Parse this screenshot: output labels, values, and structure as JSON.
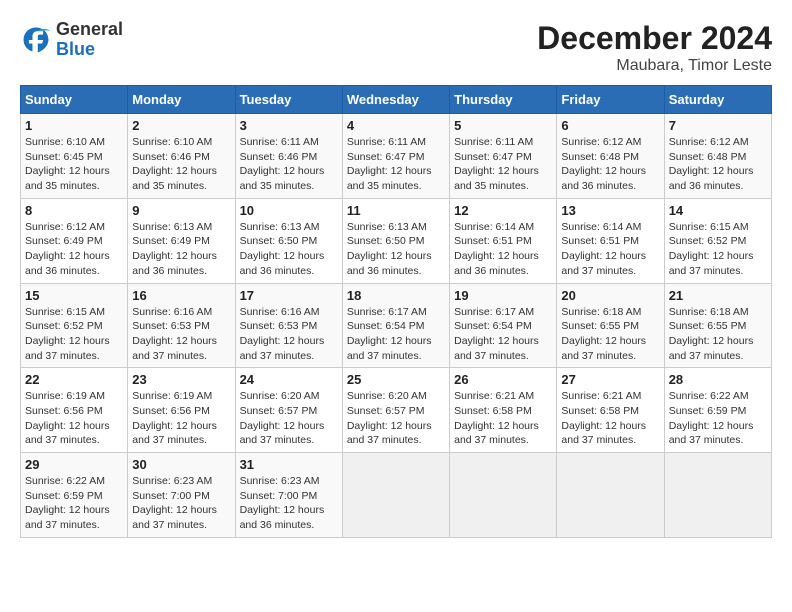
{
  "logo": {
    "general": "General",
    "blue": "Blue"
  },
  "header": {
    "month": "December 2024",
    "location": "Maubara, Timor Leste"
  },
  "weekdays": [
    "Sunday",
    "Monday",
    "Tuesday",
    "Wednesday",
    "Thursday",
    "Friday",
    "Saturday"
  ],
  "weeks": [
    [
      {
        "day": "1",
        "sunrise": "6:10 AM",
        "sunset": "6:45 PM",
        "daylight": "12 hours and 35 minutes."
      },
      {
        "day": "2",
        "sunrise": "6:10 AM",
        "sunset": "6:46 PM",
        "daylight": "12 hours and 35 minutes."
      },
      {
        "day": "3",
        "sunrise": "6:11 AM",
        "sunset": "6:46 PM",
        "daylight": "12 hours and 35 minutes."
      },
      {
        "day": "4",
        "sunrise": "6:11 AM",
        "sunset": "6:47 PM",
        "daylight": "12 hours and 35 minutes."
      },
      {
        "day": "5",
        "sunrise": "6:11 AM",
        "sunset": "6:47 PM",
        "daylight": "12 hours and 35 minutes."
      },
      {
        "day": "6",
        "sunrise": "6:12 AM",
        "sunset": "6:48 PM",
        "daylight": "12 hours and 36 minutes."
      },
      {
        "day": "7",
        "sunrise": "6:12 AM",
        "sunset": "6:48 PM",
        "daylight": "12 hours and 36 minutes."
      }
    ],
    [
      {
        "day": "8",
        "sunrise": "6:12 AM",
        "sunset": "6:49 PM",
        "daylight": "12 hours and 36 minutes."
      },
      {
        "day": "9",
        "sunrise": "6:13 AM",
        "sunset": "6:49 PM",
        "daylight": "12 hours and 36 minutes."
      },
      {
        "day": "10",
        "sunrise": "6:13 AM",
        "sunset": "6:50 PM",
        "daylight": "12 hours and 36 minutes."
      },
      {
        "day": "11",
        "sunrise": "6:13 AM",
        "sunset": "6:50 PM",
        "daylight": "12 hours and 36 minutes."
      },
      {
        "day": "12",
        "sunrise": "6:14 AM",
        "sunset": "6:51 PM",
        "daylight": "12 hours and 36 minutes."
      },
      {
        "day": "13",
        "sunrise": "6:14 AM",
        "sunset": "6:51 PM",
        "daylight": "12 hours and 37 minutes."
      },
      {
        "day": "14",
        "sunrise": "6:15 AM",
        "sunset": "6:52 PM",
        "daylight": "12 hours and 37 minutes."
      }
    ],
    [
      {
        "day": "15",
        "sunrise": "6:15 AM",
        "sunset": "6:52 PM",
        "daylight": "12 hours and 37 minutes."
      },
      {
        "day": "16",
        "sunrise": "6:16 AM",
        "sunset": "6:53 PM",
        "daylight": "12 hours and 37 minutes."
      },
      {
        "day": "17",
        "sunrise": "6:16 AM",
        "sunset": "6:53 PM",
        "daylight": "12 hours and 37 minutes."
      },
      {
        "day": "18",
        "sunrise": "6:17 AM",
        "sunset": "6:54 PM",
        "daylight": "12 hours and 37 minutes."
      },
      {
        "day": "19",
        "sunrise": "6:17 AM",
        "sunset": "6:54 PM",
        "daylight": "12 hours and 37 minutes."
      },
      {
        "day": "20",
        "sunrise": "6:18 AM",
        "sunset": "6:55 PM",
        "daylight": "12 hours and 37 minutes."
      },
      {
        "day": "21",
        "sunrise": "6:18 AM",
        "sunset": "6:55 PM",
        "daylight": "12 hours and 37 minutes."
      }
    ],
    [
      {
        "day": "22",
        "sunrise": "6:19 AM",
        "sunset": "6:56 PM",
        "daylight": "12 hours and 37 minutes."
      },
      {
        "day": "23",
        "sunrise": "6:19 AM",
        "sunset": "6:56 PM",
        "daylight": "12 hours and 37 minutes."
      },
      {
        "day": "24",
        "sunrise": "6:20 AM",
        "sunset": "6:57 PM",
        "daylight": "12 hours and 37 minutes."
      },
      {
        "day": "25",
        "sunrise": "6:20 AM",
        "sunset": "6:57 PM",
        "daylight": "12 hours and 37 minutes."
      },
      {
        "day": "26",
        "sunrise": "6:21 AM",
        "sunset": "6:58 PM",
        "daylight": "12 hours and 37 minutes."
      },
      {
        "day": "27",
        "sunrise": "6:21 AM",
        "sunset": "6:58 PM",
        "daylight": "12 hours and 37 minutes."
      },
      {
        "day": "28",
        "sunrise": "6:22 AM",
        "sunset": "6:59 PM",
        "daylight": "12 hours and 37 minutes."
      }
    ],
    [
      {
        "day": "29",
        "sunrise": "6:22 AM",
        "sunset": "6:59 PM",
        "daylight": "12 hours and 37 minutes."
      },
      {
        "day": "30",
        "sunrise": "6:23 AM",
        "sunset": "7:00 PM",
        "daylight": "12 hours and 37 minutes."
      },
      {
        "day": "31",
        "sunrise": "6:23 AM",
        "sunset": "7:00 PM",
        "daylight": "12 hours and 36 minutes."
      },
      null,
      null,
      null,
      null
    ]
  ],
  "labels": {
    "sunrise": "Sunrise:",
    "sunset": "Sunset:",
    "daylight": "Daylight:"
  }
}
